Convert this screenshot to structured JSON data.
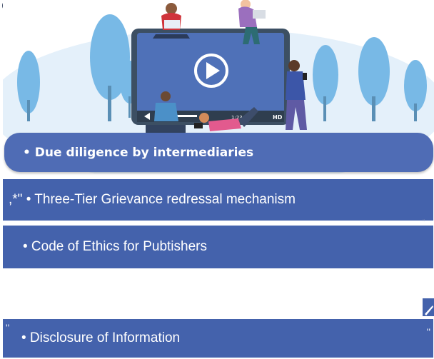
{
  "top_mark": "g",
  "bullets": [
    {
      "text": "• Due diligence by intermediaries"
    },
    {
      "prefix": ",*\"",
      "text": " • Three-Tier Grievance redressal mechanism"
    },
    {
      "text": "• Code of Ethics for Pubtishers"
    },
    {
      "text": "• Disclosure of Information"
    }
  ],
  "player": {
    "time": "1:23:55",
    "hd_label": "HD",
    "play_icon": "play-icon"
  },
  "colors": {
    "band": "#4462ac",
    "band_top": "#4f6cb5",
    "sky": "#e4f0fa",
    "tree": "#78b9e6",
    "screen_frame": "#3c4f63",
    "screen": "#4f71b8"
  }
}
